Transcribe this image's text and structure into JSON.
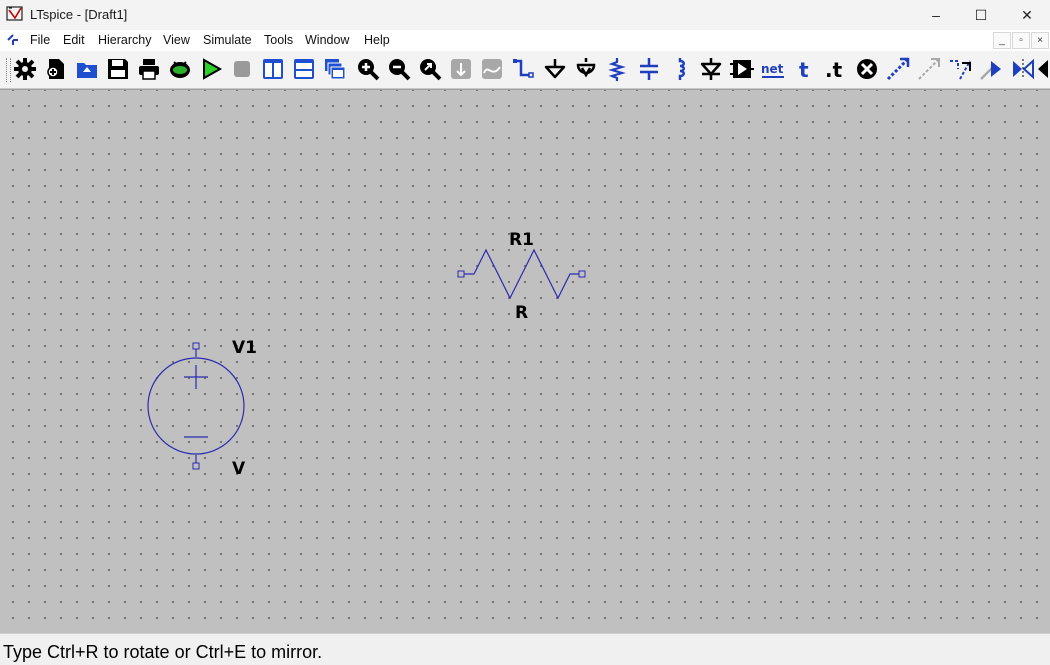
{
  "window": {
    "title": "LTspice - [Draft1]",
    "controls": {
      "minimize": "–",
      "maximize": "☐",
      "close": "✕"
    }
  },
  "menubar": {
    "items": [
      "File",
      "Edit",
      "Hierarchy",
      "View",
      "Simulate",
      "Tools",
      "Window",
      "Help"
    ],
    "mdi": {
      "minimize": "_",
      "restore": "▫",
      "close": "×"
    }
  },
  "toolbar": {
    "buttons": [
      {
        "icon": "gear-icon",
        "name": "control-panel"
      },
      {
        "icon": "new-schematic-icon",
        "name": "new-schematic"
      },
      {
        "icon": "open-icon",
        "name": "open"
      },
      {
        "icon": "save-icon",
        "name": "save"
      },
      {
        "icon": "print-icon",
        "name": "print"
      },
      {
        "icon": "spice-netlist-icon",
        "name": "spice-netlist"
      },
      {
        "icon": "run-icon",
        "name": "run"
      },
      {
        "icon": "halt-icon",
        "name": "halt"
      },
      {
        "icon": "tile-vertical-icon",
        "name": "tile-vertically"
      },
      {
        "icon": "tile-horizontal-icon",
        "name": "tile-horizontally"
      },
      {
        "icon": "cascade-icon",
        "name": "cascade-windows"
      },
      {
        "icon": "zoom-in-icon",
        "name": "zoom-in"
      },
      {
        "icon": "zoom-out-icon",
        "name": "zoom-out"
      },
      {
        "icon": "zoom-fit-icon",
        "name": "zoom-to-fit"
      },
      {
        "icon": "autorange-icon",
        "name": "autorange"
      },
      {
        "icon": "waveform-icon",
        "name": "waveform"
      },
      {
        "icon": "wire-icon",
        "name": "draw-wire"
      },
      {
        "icon": "ground-icon",
        "name": "place-ground"
      },
      {
        "icon": "label-net-icon",
        "name": "label-net"
      },
      {
        "icon": "resistor-icon",
        "name": "place-resistor"
      },
      {
        "icon": "capacitor-icon",
        "name": "place-capacitor"
      },
      {
        "icon": "inductor-icon",
        "name": "place-inductor"
      },
      {
        "icon": "diode-icon",
        "name": "place-diode"
      },
      {
        "icon": "component-icon",
        "name": "place-component"
      },
      {
        "icon": "netlist-icon",
        "name": "netlist"
      },
      {
        "icon": "text-icon",
        "name": "place-text"
      },
      {
        "icon": "spice-directive-icon",
        "name": "spice-directive"
      },
      {
        "icon": "delete-icon",
        "name": "delete"
      },
      {
        "icon": "duplicate-icon",
        "name": "duplicate"
      },
      {
        "icon": "move-icon",
        "name": "move"
      },
      {
        "icon": "drag-icon",
        "name": "drag"
      },
      {
        "icon": "undo-icon",
        "name": "undo"
      },
      {
        "icon": "redo-icon",
        "name": "redo"
      },
      {
        "icon": "rotate-icon",
        "name": "rotate"
      }
    ],
    "tooltips": {
      "netlist": "net",
      "text": "t",
      "directive": ".t"
    }
  },
  "schematic": {
    "resistor": {
      "refdes": "R1",
      "value": "R"
    },
    "voltage_source": {
      "refdes": "V1",
      "value": "V"
    },
    "symbol_color": "#2a2ab0"
  },
  "status": {
    "message": "Type Ctrl+R to rotate or Ctrl+E to mirror."
  }
}
